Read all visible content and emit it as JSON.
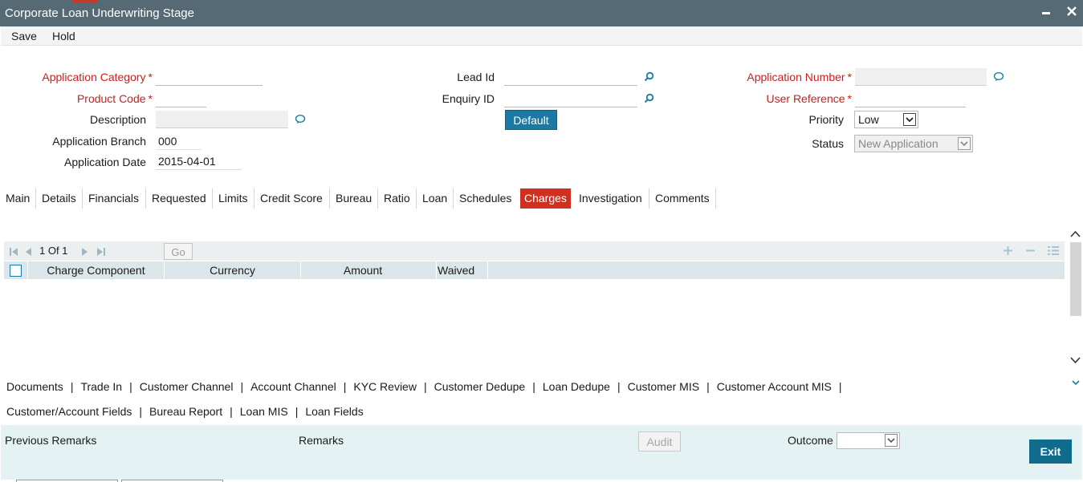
{
  "window": {
    "title": "Corporate Loan Underwriting Stage",
    "minimize_label": "–",
    "close_label": "✕"
  },
  "menu": {
    "save": "Save",
    "hold": "Hold"
  },
  "form": {
    "application_category": {
      "label": "Application Category",
      "required": "*",
      "value": ""
    },
    "product_code": {
      "label": "Product Code",
      "required": "*",
      "value": ""
    },
    "description": {
      "label": "Description",
      "value": ""
    },
    "application_branch": {
      "label": "Application Branch",
      "value": "000"
    },
    "application_date": {
      "label": "Application Date",
      "value": "2015-04-01"
    },
    "lead_id": {
      "label": "Lead Id",
      "value": ""
    },
    "enquiry_id": {
      "label": "Enquiry ID",
      "value": ""
    },
    "default_button": "Default",
    "application_number": {
      "label": "Application Number",
      "required": "*",
      "value": ""
    },
    "user_reference": {
      "label": "User Reference",
      "required": "*",
      "value": ""
    },
    "priority": {
      "label": "Priority",
      "value": "Low"
    },
    "status": {
      "label": "Status",
      "value": "New Application"
    }
  },
  "tabs": [
    {
      "label": "Main"
    },
    {
      "label": "Details"
    },
    {
      "label": "Financials"
    },
    {
      "label": "Requested"
    },
    {
      "label": "Limits"
    },
    {
      "label": "Credit Score"
    },
    {
      "label": "Bureau"
    },
    {
      "label": "Ratio"
    },
    {
      "label": "Loan"
    },
    {
      "label": "Schedules"
    },
    {
      "label": "Charges"
    },
    {
      "label": "Investigation"
    },
    {
      "label": "Comments"
    }
  ],
  "active_tab": "Charges",
  "grid": {
    "page_indicator": "1 Of 1",
    "go_button": "Go",
    "columns": [
      "Charge Component",
      "Currency",
      "Amount",
      "Waived"
    ],
    "rows": []
  },
  "link_row1": [
    "Documents",
    "Trade In",
    "Customer Channel",
    "Account Channel",
    "KYC Review",
    "Customer Dedupe",
    "Loan Dedupe",
    "Customer MIS",
    "Customer Account MIS"
  ],
  "link_row2": [
    "Customer/Account Fields",
    "Bureau Report",
    "Loan MIS",
    "Loan Fields"
  ],
  "footer": {
    "previous_remarks": "Previous Remarks",
    "remarks": "Remarks",
    "audit": "Audit",
    "outcome": "Outcome",
    "outcome_value": "",
    "exit": "Exit"
  },
  "colors": {
    "titlebar": "#556a75",
    "active_tab": "#cf3020",
    "required_label": "#c8201f",
    "primary_button": "#1a7aa4",
    "exit_button": "#106c8d",
    "footer_bg": "#e5f2f3"
  }
}
